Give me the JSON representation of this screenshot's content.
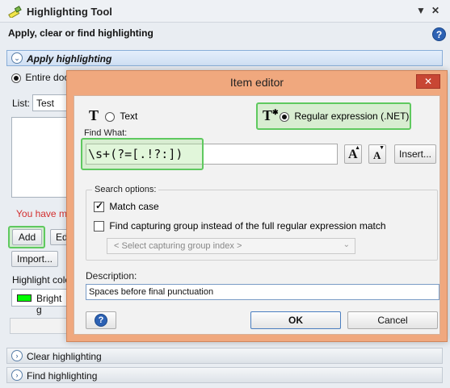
{
  "tool": {
    "title": "Highlighting Tool",
    "pin": "✕",
    "menu_arrow": "▼",
    "subtitle": "Apply, clear or find highlighting",
    "help": "?"
  },
  "sections": {
    "apply": "Apply highlighting",
    "clear": "Clear highlighting",
    "find": "Find highlighting"
  },
  "apply_panel": {
    "scope_label": "Entire doc",
    "list_label": "List:",
    "list_value": "Test",
    "warning": "You have ma",
    "add": "Add",
    "edit": "Ed",
    "import": "Import...",
    "highlight_color_label": "Highlight colo",
    "color_name": "Bright g",
    "color_hex": "#00ff00"
  },
  "dialog": {
    "title": "Item editor",
    "close": "✕",
    "text_option": "Text",
    "regex_option": "Regular expression (.NET)",
    "find_what_label": "Find What:",
    "find_what_value": "\\s+(?=[.!?:])",
    "grow_font": "A",
    "shrink_font": "A",
    "insert": "Insert...",
    "search_options_label": "Search options:",
    "match_case": "Match case",
    "capturing_group": "Find capturing group instead of the full regular expression match",
    "capturing_group_placeholder": "< Select capturing group index >",
    "description_label": "Description:",
    "description_value": "Spaces before final punctuation",
    "help": "?",
    "ok": "OK",
    "cancel": "Cancel"
  },
  "colors": {
    "dialog_border": "#f0a87e",
    "highlight": "#5fc95f",
    "close_red": "#c84634"
  }
}
